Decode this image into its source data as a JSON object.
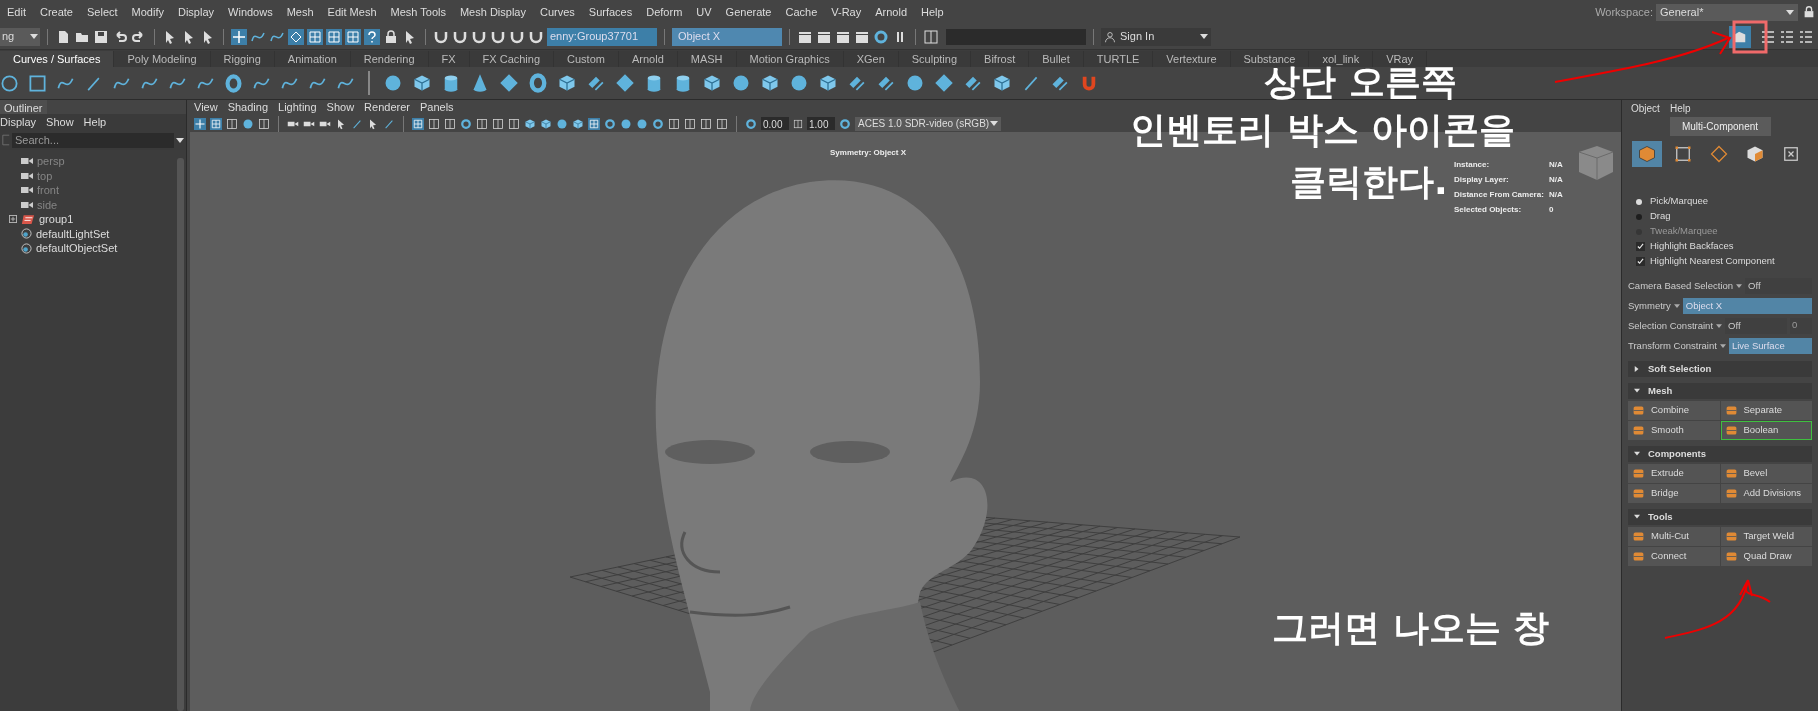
{
  "menu_bar": {
    "mode_dropdown": "ng",
    "items": [
      "Edit",
      "Create",
      "Select",
      "Modify",
      "Display",
      "Windows",
      "Mesh",
      "Edit Mesh",
      "Mesh Tools",
      "Mesh Display",
      "Curves",
      "Surfaces",
      "Deform",
      "UV",
      "Generate",
      "Cache",
      "V-Ray",
      "Arnold",
      "Help"
    ],
    "workspace_label": "Workspace:",
    "workspace": "General*"
  },
  "status_line": {
    "name_field": "enny:Group37701",
    "symmetry_field": "Object X",
    "sign_in": "Sign In"
  },
  "shelf": {
    "tabs": [
      {
        "label": "Curves / Surfaces",
        "selected": true
      },
      {
        "label": "Poly Modeling",
        "selected": false
      },
      {
        "label": "Rigging",
        "selected": false
      },
      {
        "label": "Animation",
        "selected": false
      },
      {
        "label": "Rendering",
        "selected": false
      },
      {
        "label": "FX",
        "selected": false
      },
      {
        "label": "FX Caching",
        "selected": false
      },
      {
        "label": "Custom",
        "selected": false
      },
      {
        "label": "Arnold",
        "selected": false
      },
      {
        "label": "MASH",
        "selected": false
      },
      {
        "label": "Motion Graphics",
        "selected": false
      },
      {
        "label": "XGen",
        "selected": false
      },
      {
        "label": "Sculpting",
        "selected": false
      },
      {
        "label": "Bifrost",
        "selected": false
      },
      {
        "label": "Bullet",
        "selected": false
      },
      {
        "label": "TURTLE",
        "selected": false
      },
      {
        "label": "Vertexture",
        "selected": false
      },
      {
        "label": "Substance",
        "selected": false
      },
      {
        "label": "xol_link",
        "selected": false
      },
      {
        "label": "VRay",
        "selected": false
      }
    ]
  },
  "outliner": {
    "title": "Outliner",
    "menu": [
      "Display",
      "Show",
      "Help"
    ],
    "search": {
      "placeholder": "Search..."
    },
    "items": [
      {
        "label": "persp",
        "kind": "camera",
        "dimmed": true
      },
      {
        "label": "top",
        "kind": "camera",
        "dimmed": true
      },
      {
        "label": "front",
        "kind": "camera",
        "dimmed": true
      },
      {
        "label": "side",
        "kind": "camera",
        "dimmed": true
      },
      {
        "label": "group1",
        "kind": "group",
        "dimmed": false
      },
      {
        "label": "defaultLightSet",
        "kind": "set",
        "dimmed": false
      },
      {
        "label": "defaultObjectSet",
        "kind": "set",
        "dimmed": false
      }
    ]
  },
  "viewport": {
    "menu": [
      "View",
      "Shading",
      "Lighting",
      "Show",
      "Renderer",
      "Panels"
    ],
    "exposure": "0.00",
    "gamma": "1.00",
    "color_space": "ACES 1.0 SDR-video (sRGB)",
    "symmetry_label": "Symmetry: Object X",
    "hud": [
      {
        "label": "Instance:",
        "value": "N/A"
      },
      {
        "label": "Display Layer:",
        "value": "N/A"
      },
      {
        "label": "Distance From Camera:",
        "value": "N/A"
      },
      {
        "label": "Selected Objects:",
        "value": "0"
      }
    ]
  },
  "modeling_toolkit": {
    "menu": [
      "Object",
      "Help"
    ],
    "mode_button": "Multi-Component",
    "component_modes": [
      {
        "kind": "object",
        "selected": true
      },
      {
        "kind": "vertex",
        "selected": false
      },
      {
        "kind": "edge",
        "selected": false
      },
      {
        "kind": "face",
        "selected": false
      },
      {
        "kind": "uv",
        "selected": false
      }
    ],
    "pick_modes": [
      {
        "label": "Pick/Marquee",
        "selected": true,
        "disabled": false
      },
      {
        "label": "Drag",
        "selected": false,
        "disabled": false
      },
      {
        "label": "Tweak/Marquee",
        "selected": false,
        "disabled": true
      }
    ],
    "options": [
      {
        "label": "Highlight Backfaces",
        "checked": true
      },
      {
        "label": "Highlight Nearest Component",
        "checked": true
      }
    ],
    "properties": [
      {
        "label": "Camera Based Selection",
        "value": "Off",
        "highlighted": false
      },
      {
        "label": "Symmetry",
        "value": "Object X",
        "highlighted": true
      },
      {
        "label": "Selection Constraint",
        "value": "Off",
        "extra": "0",
        "highlighted": false
      },
      {
        "label": "Transform Constraint",
        "value": "Live Surface",
        "highlighted": true
      }
    ],
    "sections": [
      {
        "title": "Soft Selection",
        "expanded": false
      },
      {
        "title": "Mesh",
        "expanded": true,
        "buttons": [
          {
            "label": "Combine",
            "highlighted": false
          },
          {
            "label": "Separate",
            "highlighted": false
          },
          {
            "label": "Smooth",
            "highlighted": false
          },
          {
            "label": "Boolean",
            "highlighted": true
          }
        ]
      },
      {
        "title": "Components",
        "expanded": true,
        "buttons": [
          {
            "label": "Extrude",
            "highlighted": false
          },
          {
            "label": "Bevel",
            "highlighted": false
          },
          {
            "label": "Bridge",
            "highlighted": false
          },
          {
            "label": "Add Divisions",
            "highlighted": false
          }
        ]
      },
      {
        "title": "Tools",
        "expanded": true,
        "buttons": [
          {
            "label": "Multi-Cut",
            "highlighted": false
          },
          {
            "label": "Target Weld",
            "highlighted": false
          },
          {
            "label": "Connect",
            "highlighted": false
          },
          {
            "label": "Quad Draw",
            "highlighted": false
          }
        ]
      }
    ]
  },
  "annotations": [
    {
      "text": "상단 오른쪽"
    },
    {
      "text": "인벤토리 박스 아이콘을"
    },
    {
      "text": "클릭한다."
    },
    {
      "text": "그러면 나오는 창"
    }
  ]
}
